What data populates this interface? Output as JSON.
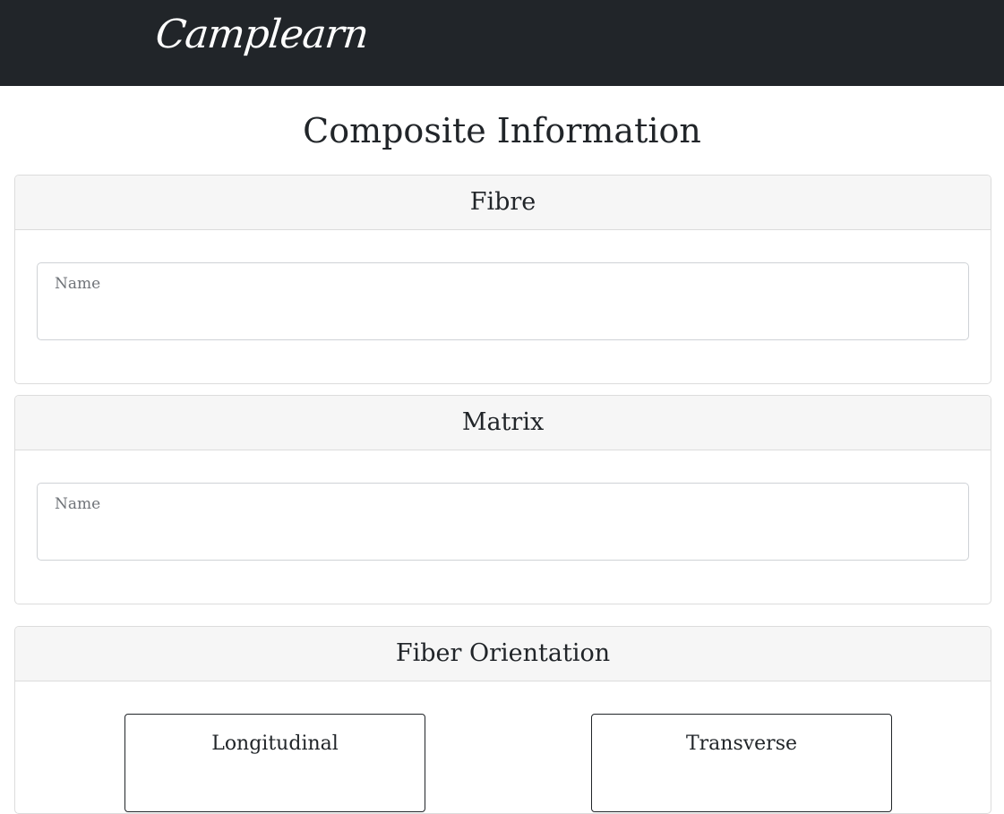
{
  "navbar": {
    "brand": "Camplearn"
  },
  "page": {
    "title": "Composite Information"
  },
  "fibre": {
    "header": "Fibre",
    "name_label": "Name",
    "name_value": ""
  },
  "matrix": {
    "header": "Matrix",
    "name_label": "Name",
    "name_value": ""
  },
  "orientation": {
    "header": "Fiber Orientation",
    "options": [
      {
        "label": "Longitudinal"
      },
      {
        "label": "Transverse"
      }
    ]
  }
}
